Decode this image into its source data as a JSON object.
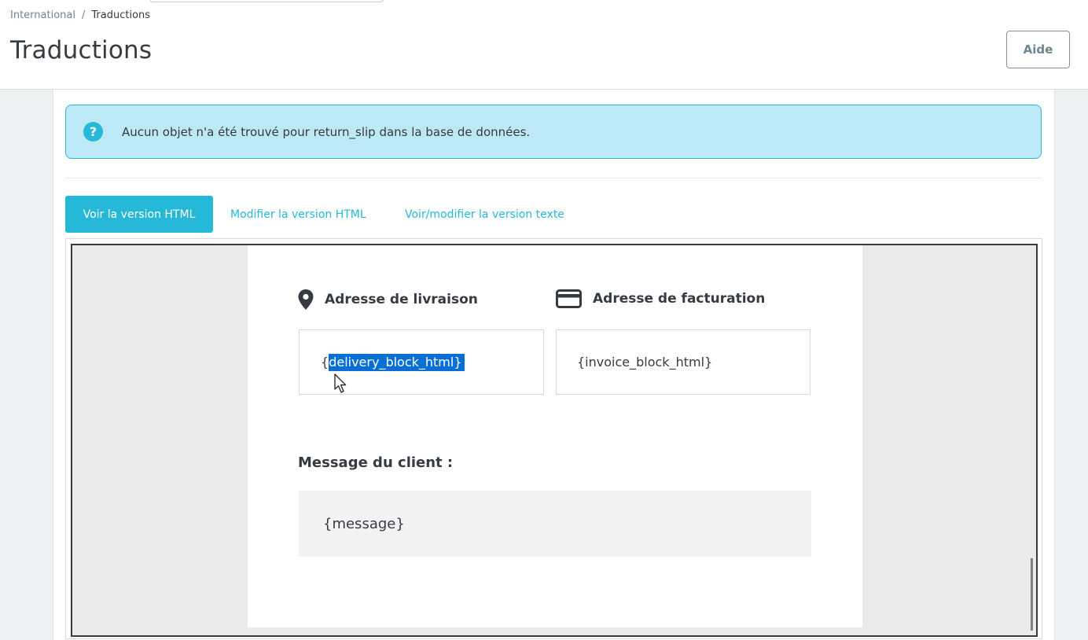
{
  "breadcrumb": {
    "parent": "International",
    "separator": "/",
    "current": "Traductions"
  },
  "page_title": "Traductions",
  "header": {
    "help_label": "Aide"
  },
  "alert": {
    "icon": "question-circle-icon",
    "text": "Aucun objet n'a été trouvé pour return_slip dans la base de données."
  },
  "tabs": [
    {
      "label": "Voir la version HTML",
      "active": true
    },
    {
      "label": "Modifier la version HTML",
      "active": false
    },
    {
      "label": "Voir/modifier la version texte",
      "active": false
    }
  ],
  "preview": {
    "delivery": {
      "title": "Adresse de livraison",
      "icon": "map-marker-icon",
      "value_prefix": "{",
      "value_selected": "delivery_block_html}"
    },
    "invoice": {
      "title": "Adresse de facturation",
      "icon": "credit-card-icon",
      "value": "{invoice_block_html}"
    },
    "message": {
      "label": "Message du client :",
      "value": "{message}"
    }
  },
  "colors": {
    "accent": "#25b9d7",
    "alert_bg": "#bde9f6",
    "selection": "#0a6fd4"
  }
}
